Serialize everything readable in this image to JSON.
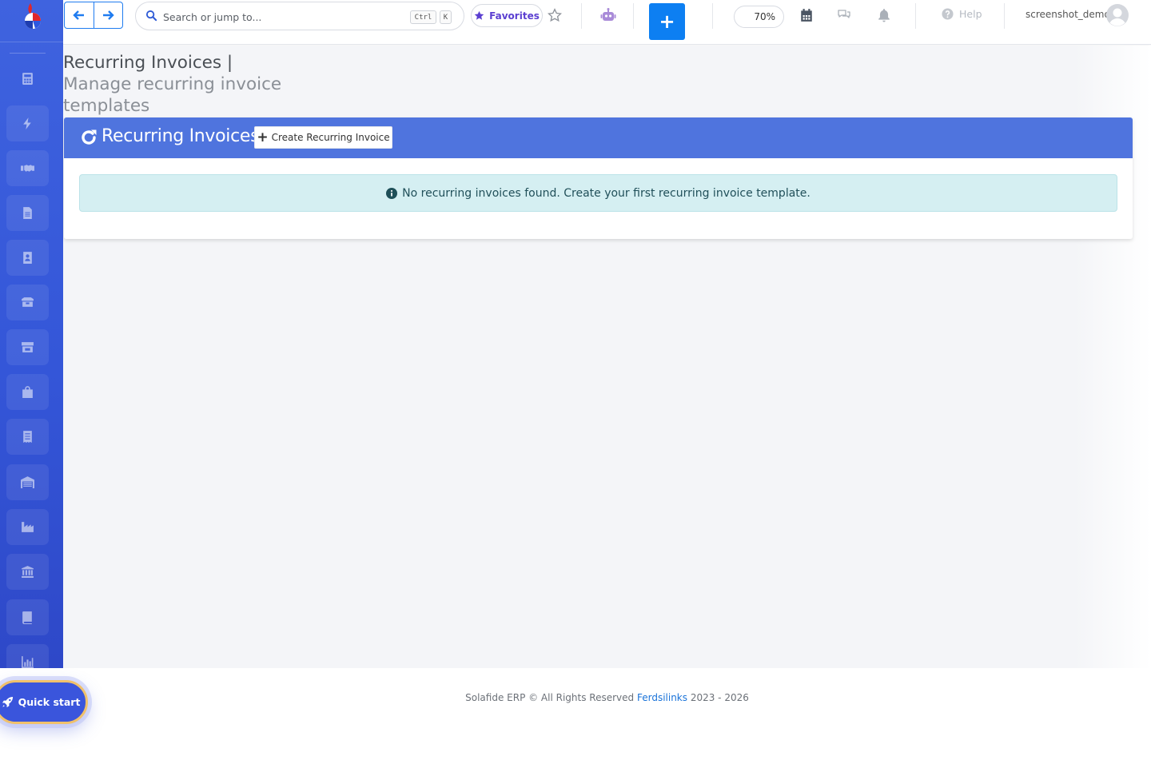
{
  "topbar": {
    "search_placeholder": "Search or jump to...",
    "kbd_ctrl": "Ctrl",
    "kbd_k": "K",
    "favorites_label": "Favorites",
    "zoom_level": "70%",
    "help_label": "Help",
    "username": "screenshot_demo"
  },
  "page": {
    "title": "Recurring Invoices |",
    "subtitle": "Manage recurring invoice templates"
  },
  "card": {
    "title": "Recurring Invoices",
    "create_button": "Create Recurring Invoice",
    "empty_message": "No recurring invoices found. Create your first recurring invoice template."
  },
  "footer": {
    "prefix": "Solafide ERP © All Rights Reserved",
    "company": "Ferdsilinks",
    "years": "2023 - 2026"
  },
  "quick_start": {
    "label": "Quick start"
  },
  "sidebar": {
    "icons": [
      "calculator-icon",
      "bolt-icon",
      "handshake-icon",
      "file-icon",
      "contact-icon",
      "boxes-icon",
      "store-icon",
      "shopping-bag-icon",
      "receipt-icon",
      "warehouse-icon",
      "industry-icon",
      "bank-icon",
      "book-icon",
      "chart-icon"
    ]
  },
  "colors": {
    "sidebar": "#3456d8",
    "card_header": "#4f74de",
    "primary_button": "#0d7ff2",
    "alert_bg": "#d5eff2",
    "quick_start_border": "#f0c16b"
  }
}
